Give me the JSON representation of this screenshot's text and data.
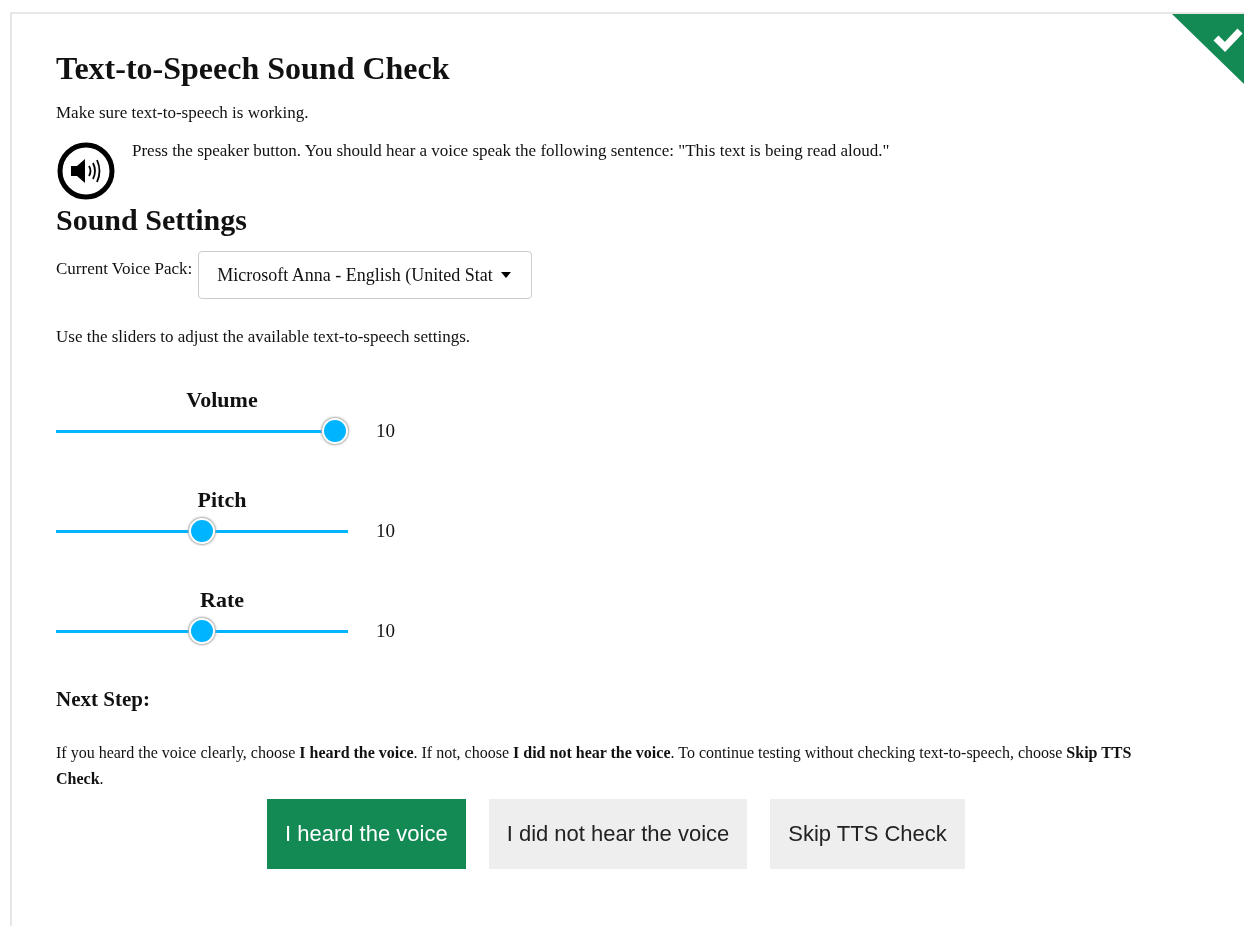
{
  "title": "Text-to-Speech Sound Check",
  "completed": true,
  "intro": "Make sure text-to-speech is working.",
  "instruction": "Press the speaker button. You should hear a voice speak the following sentence: \"This text is being read aloud.\"",
  "settings_heading": "Sound Settings",
  "voice_pack": {
    "label": "Current Voice Pack:",
    "value": "Microsoft Anna - English (United Stat"
  },
  "sliders_hint": "Use the sliders to adjust the available text-to-speech settings.",
  "sliders": [
    {
      "label": "Volume",
      "level": 1,
      "reading": "10"
    },
    {
      "label": "Pitch",
      "level": 0.5,
      "reading": "10"
    },
    {
      "label": "Rate",
      "level": 0.5,
      "reading": "10"
    }
  ],
  "next_step": {
    "heading": "Next Step:",
    "text": "If you heard the voice clearly, choose **I heard the voice**. If not, choose **I did not hear the voice**. To continue testing without checking text-to-speech, choose **Skip TTS Check**."
  },
  "buttons": [
    {
      "label": "I heard the voice",
      "kind": "primary"
    },
    {
      "label": "I did not hear the voice",
      "kind": "secondary"
    },
    {
      "label": "Skip TTS Check",
      "kind": "secondary"
    }
  ]
}
